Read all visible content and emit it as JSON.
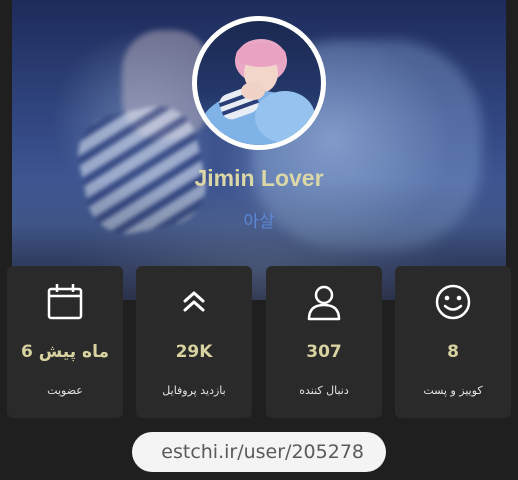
{
  "profile": {
    "display_name": "Jimin Lover",
    "username": "아살"
  },
  "stats": [
    {
      "icon": "smile-icon",
      "value": "8",
      "label": "کوییز و پست"
    },
    {
      "icon": "user-icon",
      "value": "307",
      "label": "دنبال کننده"
    },
    {
      "icon": "double-chevron-up-icon",
      "value": "29K",
      "label": "بازدید پروفایل"
    },
    {
      "icon": "calendar-icon",
      "value": "6 ماه پیش",
      "label": "عضویت"
    }
  ],
  "profile_url": "estchi.ir/user/205278",
  "colors": {
    "background": "#1f1f1f",
    "card": "#2a2a2a",
    "name": "#dcd7a6",
    "username": "#5b86d6",
    "value": "#d8d2a0"
  }
}
